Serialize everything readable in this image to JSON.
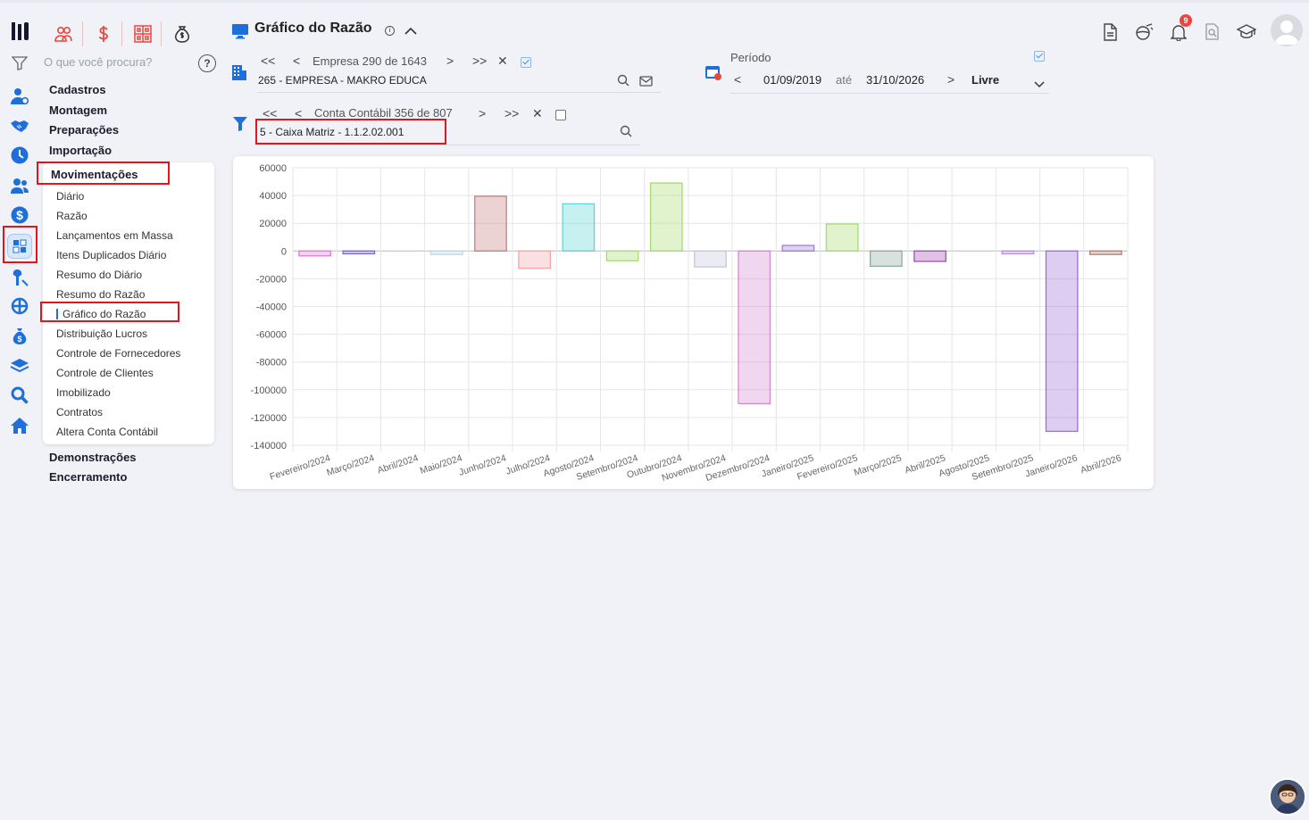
{
  "header": {
    "title": "Gráfico do Razão",
    "info_symbol": "i",
    "notifications_count": "9"
  },
  "sidebar": {
    "search_placeholder": "O que você procura?",
    "help_symbol": "?",
    "groups": [
      "Cadastros",
      "Montagem",
      "Preparações",
      "Importação",
      "Movimentações",
      "Demonstrações",
      "Encerramento"
    ],
    "sub_items": [
      "Diário",
      "Razão",
      "Lançamentos em Massa",
      "Itens Duplicados Diário",
      "Resumo do Diário",
      "Resumo do Razão",
      "Gráfico do Razão",
      "Distribuição Lucros",
      "Controle de Fornecedores",
      "Controle de Clientes",
      "Imobilizado",
      "Contratos",
      "Altera Conta Contábil"
    ],
    "active_sub_item": "Gráfico do Razão"
  },
  "empresa": {
    "first": "<<",
    "prev": "<",
    "label": "Empresa",
    "counter": "290 de 1643",
    "next": ">",
    "last": ">>",
    "clear": "✕",
    "value": "265 - EMPRESA - MAKRO EDUCA"
  },
  "conta": {
    "first": "<<",
    "prev": "<",
    "label": "Conta Contábil",
    "counter": "356 de 807",
    "next": ">",
    "last": ">>",
    "clear": "✕",
    "value": "5 - Caixa Matriz  - 1.1.2.02.001"
  },
  "periodo": {
    "label": "Período",
    "prev": "<",
    "start": "01/09/2019",
    "sep": "até",
    "end": "31/10/2026",
    "next": ">",
    "mode": "Livre"
  },
  "chart_data": {
    "type": "bar",
    "ylim": [
      -140000,
      60000
    ],
    "yticks": [
      "60000",
      "40000",
      "20000",
      "0",
      "-20000",
      "-40000",
      "-60000",
      "-80000",
      "-100000",
      "-120000",
      "-140000"
    ],
    "categories": [
      "Fevereiro/2024",
      "Março/2024",
      "Abril/2024",
      "Maio/2024",
      "Junho/2024",
      "Julho/2024",
      "Agosto/2024",
      "Setembro/2024",
      "Outubro/2024",
      "Novembro/2024",
      "Dezembro/2024",
      "Janeiro/2025",
      "Fevereiro/2025",
      "Março/2025",
      "Abril/2025",
      "Agosto/2025",
      "Setembro/2025",
      "Janeiro/2026",
      "Abril/2026"
    ],
    "values": [
      -3500,
      -2000,
      0,
      -2500,
      39500,
      -12500,
      34000,
      -7000,
      49000,
      -11500,
      -110000,
      4000,
      19500,
      -11000,
      -7500,
      0,
      -2000,
      -130000,
      -2500
    ],
    "colors": [
      "#e27ad3",
      "#7a6ad8",
      "#cccccc",
      "#b8d8ec",
      "#c88080",
      "#f2a6a6",
      "#5fd4d4",
      "#a6dc6e",
      "#a6dc6e",
      "#c7c7dc",
      "#d88ad0",
      "#a47ad8",
      "#a6dc6e",
      "#8fa8a0",
      "#a24fb2",
      "#cccccc",
      "#b590e0",
      "#9a6fd8",
      "#b88070"
    ],
    "grid": true
  }
}
